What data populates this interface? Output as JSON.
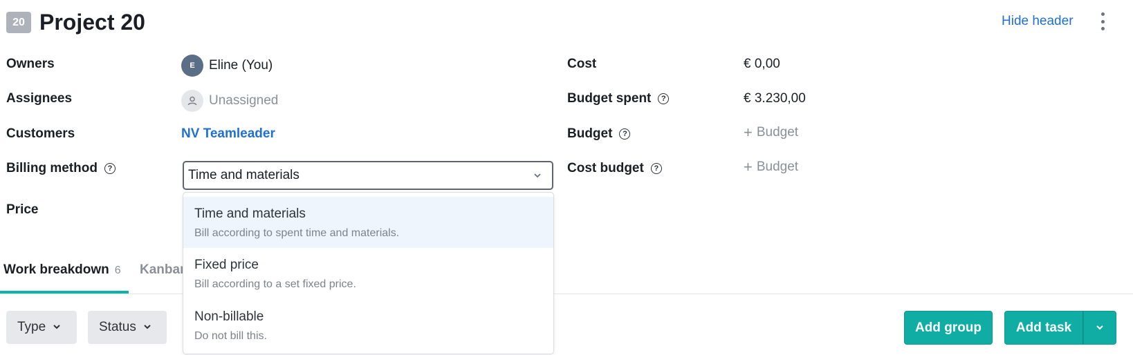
{
  "header": {
    "badge": "20",
    "title": "Project 20",
    "hide_header": "Hide header"
  },
  "fields_left": {
    "owners_label": "Owners",
    "owner_initial": "E",
    "owner_name": "Eline (You)",
    "assignees_label": "Assignees",
    "assignees_value": "Unassigned",
    "customers_label": "Customers",
    "customer_value": "NV Teamleader",
    "billing_label": "Billing method",
    "billing_value": "Time and materials",
    "price_label": "Price"
  },
  "fields_right": {
    "cost_label": "Cost",
    "cost_value": "€ 0,00",
    "budget_spent_label": "Budget spent",
    "budget_spent_value": "€ 3.230,00",
    "budget_label": "Budget",
    "budget_add": "Budget",
    "cost_budget_label": "Cost budget",
    "cost_budget_add": "Budget"
  },
  "billing_options": [
    {
      "title": "Time and materials",
      "desc": "Bill according to spent time and materials."
    },
    {
      "title": "Fixed price",
      "desc": "Bill according to a set fixed price."
    },
    {
      "title": "Non-billable",
      "desc": "Do not bill this."
    }
  ],
  "tabs": [
    {
      "label": "Work breakdown",
      "count": "6"
    },
    {
      "label": "Kanban"
    }
  ],
  "toolbar": {
    "type_filter": "Type",
    "status_filter": "Status",
    "add_group": "Add group",
    "add_task": "Add task"
  },
  "colors": {
    "accent_teal": "#0fada4",
    "link_blue": "#1f6fd6",
    "option_highlight": "#eff5fd"
  }
}
